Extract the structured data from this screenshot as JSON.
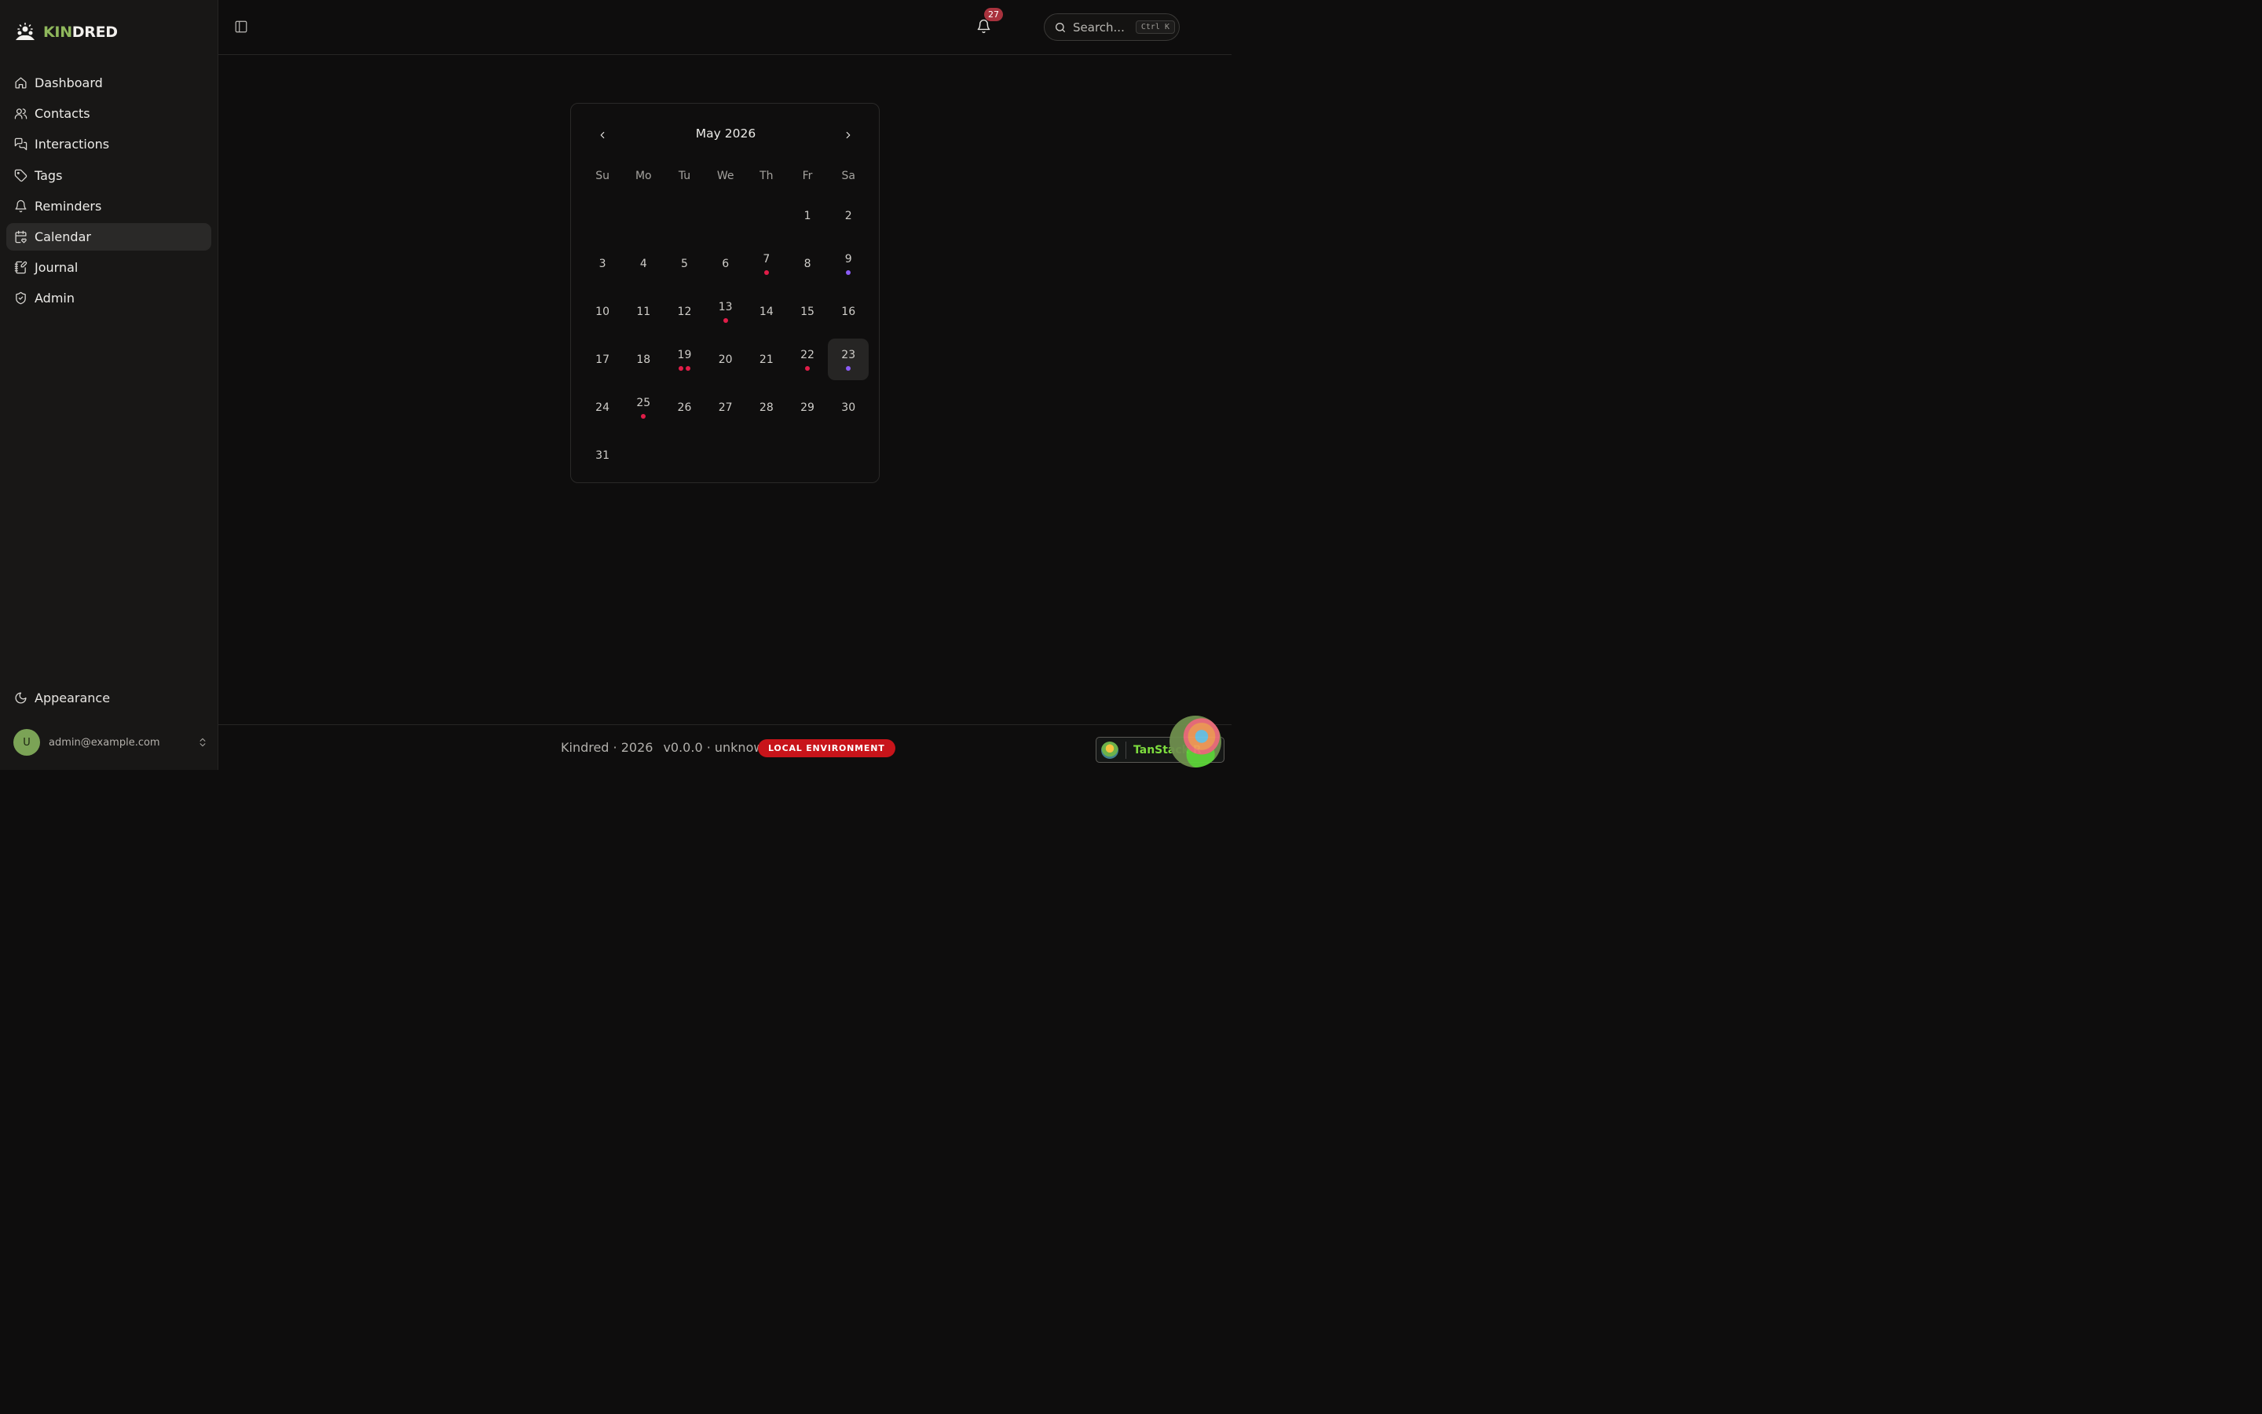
{
  "app": {
    "brand_kin": "KIN",
    "brand_dred": "DRED",
    "brand_accent": "#8fb85c"
  },
  "sidebar": {
    "items": [
      {
        "label": "Dashboard",
        "icon": "home-icon",
        "active": false
      },
      {
        "label": "Contacts",
        "icon": "users-icon",
        "active": false
      },
      {
        "label": "Interactions",
        "icon": "messages-icon",
        "active": false
      },
      {
        "label": "Tags",
        "icon": "tag-icon",
        "active": false
      },
      {
        "label": "Reminders",
        "icon": "bell-icon",
        "active": false
      },
      {
        "label": "Calendar",
        "icon": "calendar-heart-icon",
        "active": true
      },
      {
        "label": "Journal",
        "icon": "notebook-pen-icon",
        "active": false
      },
      {
        "label": "Admin",
        "icon": "shield-check-icon",
        "active": false
      }
    ],
    "appearance_label": "Appearance",
    "user": {
      "avatar_initial": "U",
      "email": "admin@example.com"
    }
  },
  "header": {
    "search_placeholder": "Search...",
    "search_shortcut": "Ctrl K",
    "notification_count": "27"
  },
  "calendar": {
    "title": "May 2026",
    "weekdays": [
      "Su",
      "Mo",
      "Tu",
      "We",
      "Th",
      "Fr",
      "Sa"
    ],
    "first_weekday_index": 5,
    "days_in_month": 31,
    "selected_day": 23,
    "event_colors": {
      "red": "#e11d48",
      "purple": "#8b5cf6"
    },
    "events": {
      "7": [
        "red"
      ],
      "9": [
        "purple"
      ],
      "13": [
        "red"
      ],
      "19": [
        "red",
        "red"
      ],
      "22": [
        "red"
      ],
      "23": [
        "purple"
      ],
      "25": [
        "red"
      ]
    }
  },
  "footer": {
    "copyright": "Kindred · 2026",
    "version": "v0.0.0 · unknown",
    "env_badge": "LOCAL ENVIRONMENT",
    "env_color": "#c8141a"
  },
  "devtools": {
    "label": "TanStack R"
  }
}
